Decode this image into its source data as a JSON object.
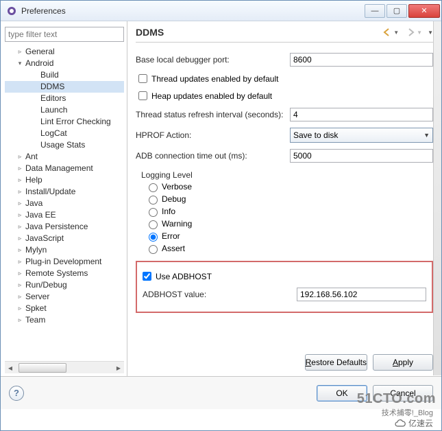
{
  "window": {
    "title": "Preferences"
  },
  "sidebar": {
    "filter_placeholder": "type filter text",
    "items": [
      {
        "label": "General",
        "level": 1,
        "expand": "closed"
      },
      {
        "label": "Android",
        "level": 1,
        "expand": "open"
      },
      {
        "label": "Build",
        "level": 2,
        "expand": "none"
      },
      {
        "label": "DDMS",
        "level": 2,
        "expand": "none",
        "selected": true
      },
      {
        "label": "Editors",
        "level": 2,
        "expand": "none"
      },
      {
        "label": "Launch",
        "level": 2,
        "expand": "none"
      },
      {
        "label": "Lint Error Checking",
        "level": 2,
        "expand": "none"
      },
      {
        "label": "LogCat",
        "level": 2,
        "expand": "none"
      },
      {
        "label": "Usage Stats",
        "level": 2,
        "expand": "none"
      },
      {
        "label": "Ant",
        "level": 1,
        "expand": "closed"
      },
      {
        "label": "Data Management",
        "level": 1,
        "expand": "closed"
      },
      {
        "label": "Help",
        "level": 1,
        "expand": "closed"
      },
      {
        "label": "Install/Update",
        "level": 1,
        "expand": "closed"
      },
      {
        "label": "Java",
        "level": 1,
        "expand": "closed"
      },
      {
        "label": "Java EE",
        "level": 1,
        "expand": "closed"
      },
      {
        "label": "Java Persistence",
        "level": 1,
        "expand": "closed"
      },
      {
        "label": "JavaScript",
        "level": 1,
        "expand": "closed"
      },
      {
        "label": "Mylyn",
        "level": 1,
        "expand": "closed"
      },
      {
        "label": "Plug-in Development",
        "level": 1,
        "expand": "closed"
      },
      {
        "label": "Remote Systems",
        "level": 1,
        "expand": "closed"
      },
      {
        "label": "Run/Debug",
        "level": 1,
        "expand": "closed"
      },
      {
        "label": "Server",
        "level": 1,
        "expand": "closed"
      },
      {
        "label": "Spket",
        "level": 1,
        "expand": "closed"
      },
      {
        "label": "Team",
        "level": 1,
        "expand": "closed"
      }
    ]
  },
  "page": {
    "title": "DDMS",
    "base_port_label": "Base local debugger port:",
    "base_port_value": "8600",
    "thread_updates_label": "Thread updates enabled by default",
    "thread_updates_checked": false,
    "heap_updates_label": "Heap updates enabled by default",
    "heap_updates_checked": false,
    "refresh_label": "Thread status refresh interval (seconds):",
    "refresh_value": "4",
    "hprof_label": "HPROF Action:",
    "hprof_value": "Save to disk",
    "adb_timeout_label": "ADB connection time out (ms):",
    "adb_timeout_value": "5000",
    "logging_group": "Logging Level",
    "logging_options": [
      "Verbose",
      "Debug",
      "Info",
      "Warning",
      "Error",
      "Assert"
    ],
    "logging_selected": "Error",
    "use_adbhost_label": "Use ADBHOST",
    "use_adbhost_checked": true,
    "adbhost_value_label": "ADBHOST value:",
    "adbhost_value": "192.168.56.102",
    "restore_label": "Restore Defaults",
    "apply_label": "Apply"
  },
  "buttons": {
    "ok": "OK",
    "cancel": "Cancel"
  },
  "watermarks": {
    "w1": "51CTO.com",
    "w2": "技术捕零!_Blog",
    "w3": "亿速云"
  }
}
